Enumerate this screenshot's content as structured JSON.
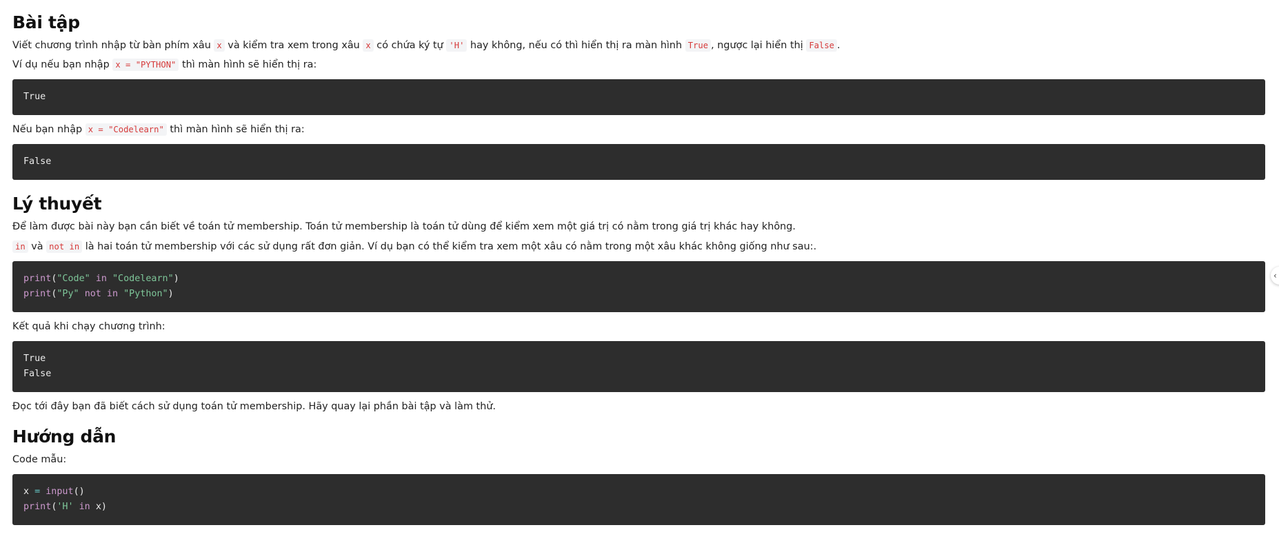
{
  "exercise": {
    "heading": "Bài tập",
    "p1": {
      "t1": "Viết chương trình nhập từ bàn phím xâu ",
      "c1": "x",
      "t2": " và kiểm tra xem trong xâu ",
      "c2": "x",
      "t3": " có chứa ký tự ",
      "c3": "'H'",
      "t4": " hay không, nếu có thì hiển thị ra màn hình ",
      "c4": "True",
      "t5": ", ngược lại hiển thị ",
      "c5": "False",
      "t6": "."
    },
    "p2": {
      "t1": "Ví dụ nếu bạn nhập ",
      "c1": "x = \"PYTHON\"",
      "t2": " thì màn hình sẽ hiển thị ra:"
    },
    "output1": "True",
    "p3": {
      "t1": "Nếu bạn nhập ",
      "c1": "x = \"Codelearn\"",
      "t2": " thì màn hình sẽ hiển thị ra:"
    },
    "output2": "False"
  },
  "theory": {
    "heading": "Lý thuyết",
    "p1": "Để làm được bài này bạn cần biết về toán tử membership. Toán tử membership là toán tử dùng để kiểm xem một giá trị có nằm trong giá trị khác hay không.",
    "p2": {
      "c1": "in",
      "t1": " và ",
      "c2": "not in",
      "t2": " là hai toán tử membership với các sử dụng rất đơn giản. Ví dụ bạn có thể kiểm tra xem một xâu có nằm trong một xâu khác không giống như sau:."
    },
    "code": {
      "l1_fn": "print",
      "l1_open": "(",
      "l1_s1": "\"Code\"",
      "l1_kw": "in",
      "l1_s2": "\"Codelearn\"",
      "l1_close": ")",
      "l2_fn": "print",
      "l2_open": "(",
      "l2_s1": "\"Py\"",
      "l2_kw": "not in",
      "l2_s2": "\"Python\"",
      "l2_close": ")"
    },
    "result_label": "Kết quả khi chạy chương trình:",
    "result_l1": "True",
    "result_l2": "False",
    "closing": "Đọc tới đây bạn đã biết cách sử dụng toán tử membership. Hãy quay lại phần bài tập và làm thử."
  },
  "guide": {
    "heading": "Hướng dẫn",
    "label": "Code mẫu:",
    "code": {
      "l1_var": "x",
      "l1_eq": "=",
      "l1_fn": "input",
      "l1_paren": "()",
      "l2_fn": "print",
      "l2_open": "(",
      "l2_s": "'H'",
      "l2_kw": "in",
      "l2_rest": "x)"
    }
  },
  "ui": {
    "edge_toggle_glyph": "‹"
  }
}
